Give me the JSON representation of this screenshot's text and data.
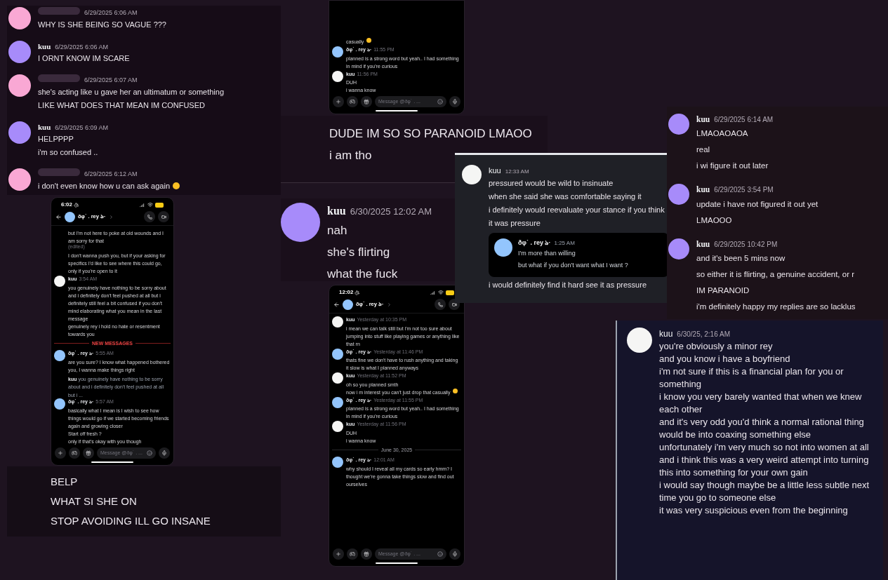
{
  "panels": [
    {
      "kind": "chat",
      "messages": [
        {
          "color": "#f9a8d4",
          "redacted": true,
          "time": "6/29/2025 6:06 AM",
          "lines": [
            "WHY IS SHE BEING SO VAGUE ???"
          ]
        },
        {
          "color": "#a78bfa",
          "author": "kuu",
          "time": "6/29/2025 6:06 AM",
          "lines": [
            "I ORNT KNOW IM SCARE"
          ]
        },
        {
          "color": "#f9a8d4",
          "redacted": true,
          "time": "6/29/2025 6:07 AM",
          "lines": [
            "she's acting like u gave her an ultimatum or something",
            "LIKE WHAT DOES THAT MEAN IM CONFUSED"
          ]
        },
        {
          "color": "#a78bfa",
          "author": "kuu",
          "time": "6/29/2025 6:09 AM",
          "lines": [
            "HELPPPP",
            "i'm so confused .."
          ]
        },
        {
          "color": "#f9a8d4",
          "redacted": true,
          "time": "6/29/2025 6:12 AM",
          "lines": [
            "i don't even know how u can ask again"
          ],
          "emoji": true
        }
      ]
    },
    {
      "kind": "phone",
      "status_time": "6:02",
      "header_name": "ðφ˙ . rey ঌ·",
      "composer_placeholder": "Message @ðφ˙ . ...",
      "items": [
        {
          "kind": "message",
          "lines": [
            "but I'm not here to poke at old wounds and I am sorry for that"
          ],
          "note": "(edited)"
        },
        {
          "kind": "message",
          "lines": [
            "I don't wanna push you, but if your asking for specifics I'd like to see where this could go, only if you're open to it"
          ]
        },
        {
          "kind": "message",
          "color": "#f5f5f4",
          "author": "kuu",
          "time": "3:54 AM",
          "lines": [
            "you genuinely have nothing to be sorry about and i definitely don't feel pushed at all but i definitely still feel a bit confused if you don't mind elaborating what you mean in the last message",
            "genuinely rey i hold no hate or resentment towards you"
          ]
        },
        {
          "kind": "divider",
          "text": "NEW MESSAGES"
        },
        {
          "kind": "message",
          "color": "#93c5fd",
          "author": "ðφ˙ . rey ঌ·",
          "time": "5:55 AM",
          "lines": [
            "are you sure? I know what happened bothered you, I wanna make things right"
          ]
        },
        {
          "kind": "message",
          "color": "#93c5fd",
          "author": "ðφ˙ . rey ঌ·",
          "time": "5:57 AM",
          "reply": {
            "author": "kuu",
            "text": "you genuinely have nothing to be sorry about and i definitely don't feel pushed at all but i ..."
          },
          "lines": [
            "basically what I mean is I wish to see how things would go if we started becoming friends again and growing closer",
            "Start off fresh ?",
            "only if that's okay with you though"
          ]
        }
      ]
    },
    {
      "kind": "lines",
      "lines": [
        "BELP",
        "WHAT SI SHE ON",
        "STOP AVOIDING ILL GO INSANE"
      ]
    },
    {
      "kind": "phone",
      "composer_placeholder": "Message @ðφ˙ . ...",
      "items": [
        {
          "kind": "message",
          "lines": [
            "casually"
          ],
          "emoji": true
        },
        {
          "kind": "message",
          "color": "#93c5fd",
          "author": "ðφ˙ . rey ঌ·",
          "time": "11:55 PM",
          "lines": [
            "planned is a strong word but yeah.. I had something in mind if you're curious"
          ]
        },
        {
          "kind": "message",
          "color": "#f5f5f4",
          "author": "kuu",
          "time": "11:56 PM",
          "lines": [
            "DUH",
            "i wanna know"
          ]
        }
      ]
    },
    {
      "kind": "lines",
      "lines": [
        "DUDE IM SO SO PARANOID LMAOO",
        "i am tho"
      ]
    },
    {
      "kind": "chat",
      "messages": [
        {
          "color": "#a78bfa",
          "author": "kuu",
          "time": "6/30/2025 12:02 AM",
          "lines": [
            "nah",
            "she's flirting",
            "what the fuck"
          ]
        }
      ]
    },
    {
      "kind": "phone",
      "status_time": "12:02",
      "header_name": "ðφ˙ . rey ঌ·",
      "composer_placeholder": "Message @ðφ˙ . ...",
      "items": [
        {
          "kind": "message",
          "color": "#f5f5f4",
          "author": "kuu",
          "time": "Yesterday at 10:35 PM",
          "lines": [
            "i mean we can talk still but i'm not too sure about jumping into stuff like playing games or anything like that rn"
          ]
        },
        {
          "kind": "message",
          "color": "#93c5fd",
          "author": "ðφ˙ . rey ঌ·",
          "time": "Yesterday at 11:46 PM",
          "lines": [
            "thats fine we don't have to rush anything and taking it slow is what I planned anyways"
          ]
        },
        {
          "kind": "message",
          "color": "#f5f5f4",
          "author": "kuu",
          "time": "Yesterday at 11:52 PM",
          "lines": [
            "oh so you planned smth",
            "now i m interest you can't just drop that casually"
          ],
          "emoji": true
        },
        {
          "kind": "message",
          "color": "#93c5fd",
          "author": "ðφ˙ . rey ঌ·",
          "time": "Yesterday at 11:55 PM",
          "lines": [
            "planned is a strong word but yeah.. I had something in mind if you're curious"
          ]
        },
        {
          "kind": "message",
          "color": "#f5f5f4",
          "author": "kuu",
          "time": "Yesterday at 11:56 PM",
          "lines": [
            "DUH",
            "i wanna know"
          ]
        },
        {
          "kind": "date",
          "text": "June 30, 2025"
        },
        {
          "kind": "message",
          "color": "#93c5fd",
          "author": "ðφ˙ . rey ঌ·",
          "time": "12:01 AM",
          "lines": [
            "why should I reveal all my cards so early hmm? I thought we're gonna take things slow and find out ourselves"
          ]
        }
      ]
    },
    {
      "kind": "chat",
      "messages": [
        {
          "color": "#f5f5f4",
          "author": "kuu",
          "time": "12:33 AM",
          "lines": [
            "pressured would be wild to insinuate",
            "when she said she was comfortable saying it",
            "i definitely would reevaluate your stance if you think it was pressure"
          ],
          "quote": {
            "color": "#93c5fd",
            "author": "ðφ˙ . rey ঌ·",
            "time": "1:25 AM",
            "lines": [
              "I'm more than willing",
              "but what if you don't want what I want ?"
            ]
          },
          "after": [
            "i would definitely find it hard see it as pressure"
          ]
        }
      ]
    },
    {
      "kind": "chat",
      "messages": [
        {
          "color": "#a78bfa",
          "author": "kuu",
          "time": "6/29/2025 6:14 AM",
          "lines": [
            "LMAOAOAOA",
            "real",
            "i wi figure it out later"
          ]
        },
        {
          "color": "#a78bfa",
          "author": "kuu",
          "time": "6/29/2025 3:54 PM",
          "lines": [
            "update i have not figured it out yet",
            "LMAOOO"
          ]
        },
        {
          "color": "#a78bfa",
          "author": "kuu",
          "time": "6/29/2025 10:42 PM",
          "lines": [
            "and it's been 5 mins now",
            "so either it is flirting, a genuine accident, or r",
            "IM PARANOID",
            "i'm definitely happy my replies are so lacklus"
          ]
        }
      ]
    },
    {
      "kind": "chat",
      "messages": [
        {
          "color": "#f5f5f4",
          "author": "kuu",
          "time": "6/30/25, 2:16 AM",
          "lines": [
            "you're obviously a minor rey",
            "and you know i have a boyfriend",
            "i'm not sure if this is a financial plan for you or something",
            "i know you very barely wanted that when we knew each other",
            "and it's very odd you'd think a normal rational thing would be into coaxing something else",
            "unfortunately i'm very much so not into women at all and i think this was a very weird attempt into turning this into something for your own gain",
            "i would say though maybe be a little less subtle next time you go to someone else",
            "it was very suspicious even from the beginning"
          ]
        }
      ]
    }
  ]
}
